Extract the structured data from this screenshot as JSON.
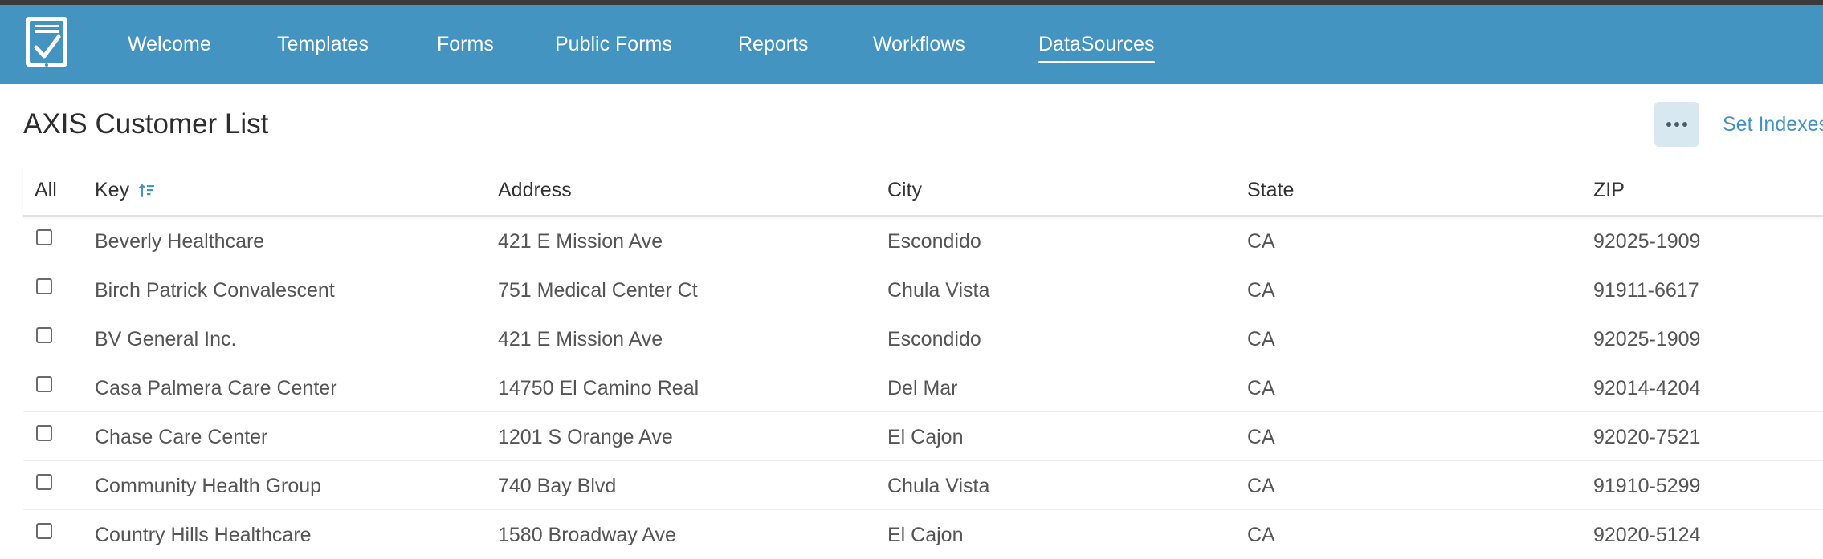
{
  "nav": {
    "items": [
      {
        "label": "Welcome",
        "active": false
      },
      {
        "label": "Templates",
        "active": false
      },
      {
        "label": "Forms",
        "active": false
      },
      {
        "label": "Public Forms",
        "active": false
      },
      {
        "label": "Reports",
        "active": false
      },
      {
        "label": "Workflows",
        "active": false
      },
      {
        "label": "DataSources",
        "active": true
      }
    ]
  },
  "colors": {
    "navbar": "#4494c1",
    "accent": "#4494c1",
    "more_button_bg": "#d8e8f0"
  },
  "page": {
    "title": "AXIS Customer List",
    "more_icon": "ellipsis-icon",
    "set_indexes_label": "Set Indexes"
  },
  "table": {
    "columns": {
      "select_all": "All",
      "key": "Key",
      "address": "Address",
      "city": "City",
      "state": "State",
      "zip": "ZIP"
    },
    "sort_icon": "sort-ascending-icon",
    "rows": [
      {
        "key": "Beverly Healthcare",
        "address": "421 E Mission Ave",
        "city": "Escondido",
        "state": "CA",
        "zip": "92025-1909"
      },
      {
        "key": "Birch Patrick Convalescent",
        "address": "751 Medical Center Ct",
        "city": "Chula Vista",
        "state": "CA",
        "zip": "91911-6617"
      },
      {
        "key": "BV General Inc.",
        "address": "421 E Mission Ave",
        "city": "Escondido",
        "state": "CA",
        "zip": "92025-1909"
      },
      {
        "key": "Casa Palmera Care Center",
        "address": "14750 El Camino Real",
        "city": "Del Mar",
        "state": "CA",
        "zip": "92014-4204"
      },
      {
        "key": "Chase Care Center",
        "address": "1201 S Orange Ave",
        "city": "El Cajon",
        "state": "CA",
        "zip": "92020-7521"
      },
      {
        "key": "Community Health Group",
        "address": "740 Bay Blvd",
        "city": "Chula Vista",
        "state": "CA",
        "zip": "91910-5299"
      },
      {
        "key": "Country Hills Healthcare",
        "address": "1580 Broadway Ave",
        "city": "El Cajon",
        "state": "CA",
        "zip": "92020-5124"
      }
    ]
  }
}
